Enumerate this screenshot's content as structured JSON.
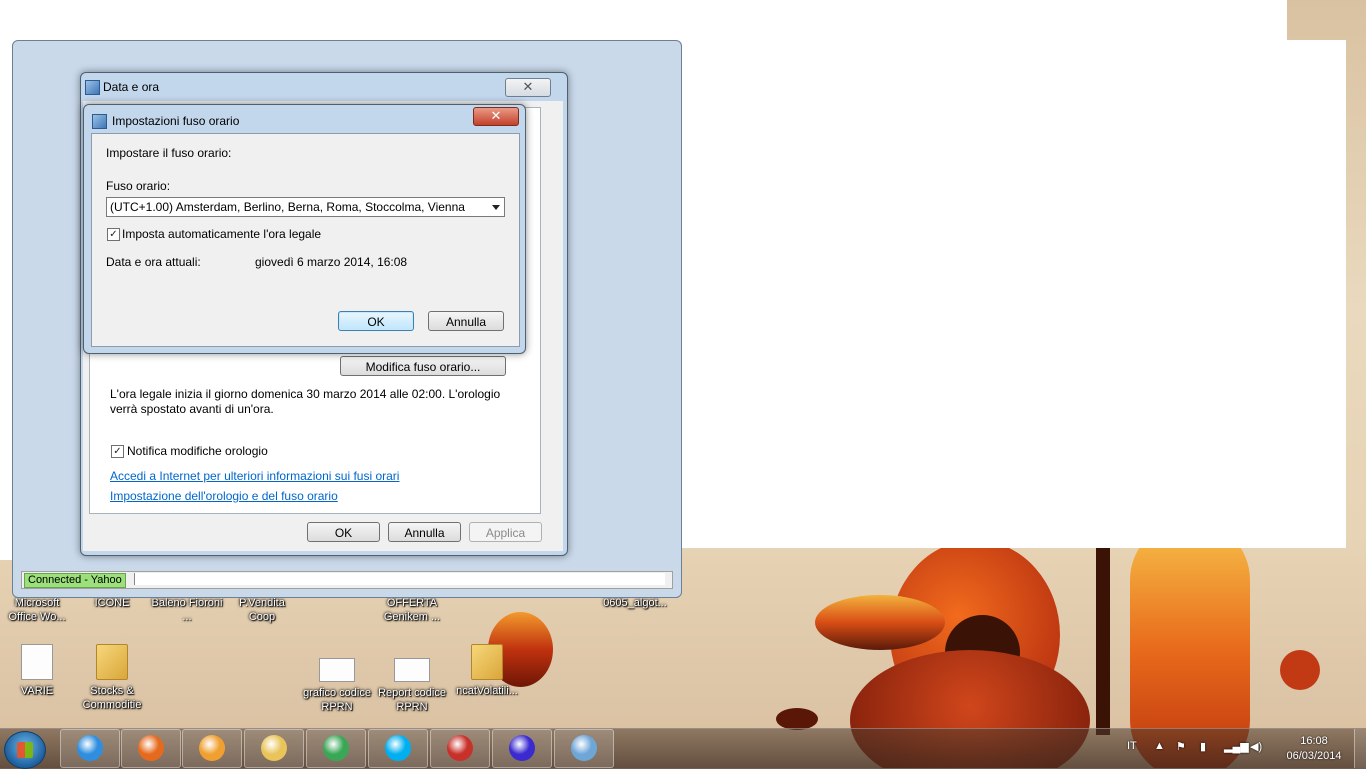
{
  "desktop": {
    "icons_row1": [
      {
        "label": "Microsoft Office Wo..."
      },
      {
        "label": "ICONE"
      },
      {
        "label": "Baleno Fioroni ..."
      },
      {
        "label": "P.Vendita Coop"
      },
      {
        "label": "OFFERTA Genikem ..."
      },
      {
        "label": "0605_algot..."
      }
    ],
    "icons_row2": [
      {
        "label": "VARIE"
      },
      {
        "label": "Stocks  & Commoditie"
      },
      {
        "label": "grafico codice RPRN"
      },
      {
        "label": "Report codice RPRN"
      },
      {
        "label": "ncatVolatili..."
      }
    ]
  },
  "yahoo_window": {
    "status": "Connected - Yahoo"
  },
  "data_ora_dialog": {
    "title": "Data e ora",
    "close_symbol": "✕",
    "change_tz_button": "Modifica fuso orario...",
    "dst_info": "L'ora legale inizia il giorno domenica 30 marzo 2014 alle 02:00. L'orologio verrà spostato avanti di un'ora.",
    "notify_checkbox": {
      "label": "Notifica modifiche orologio",
      "checked": true
    },
    "link_internet": "Accedi a Internet per ulteriori informazioni sui fusi orari",
    "link_settings": "Impostazione dell'orologio e del fuso orario",
    "ok": "OK",
    "cancel": "Annulla",
    "apply": "Applica"
  },
  "tz_dialog": {
    "title": "Impostazioni fuso orario",
    "close_symbol": "✕",
    "heading": "Impostare il fuso orario:",
    "tz_label": "Fuso orario:",
    "tz_value": "(UTC+1.00) Amsterdam, Berlino, Berna, Roma, Stoccolma, Vienna",
    "auto_dst": {
      "label": "Imposta automaticamente l'ora legale",
      "checked": true
    },
    "current_label": "Data e ora attuali:",
    "current_value": "giovedì 6 marzo 2014, 16:08",
    "ok": "OK",
    "cancel": "Annulla"
  },
  "taskbar": {
    "language": "IT",
    "time": "16:08",
    "date": "06/03/2014",
    "apps": [
      {
        "name": "internet-explorer-icon",
        "color": "#2f8ee0"
      },
      {
        "name": "firefox-icon",
        "color": "#e66a1d"
      },
      {
        "name": "media-player-icon",
        "color": "#f0a030"
      },
      {
        "name": "file-explorer-icon",
        "color": "#e8c45a"
      },
      {
        "name": "chrome-icon",
        "color": "#3aa757"
      },
      {
        "name": "skype-icon",
        "color": "#00aff0"
      },
      {
        "name": "app-red-icon",
        "color": "#c8302a"
      },
      {
        "name": "app-purple-icon",
        "color": "#3a2ad0"
      },
      {
        "name": "calendar-clock-icon",
        "color": "#6fa6d8"
      }
    ]
  }
}
